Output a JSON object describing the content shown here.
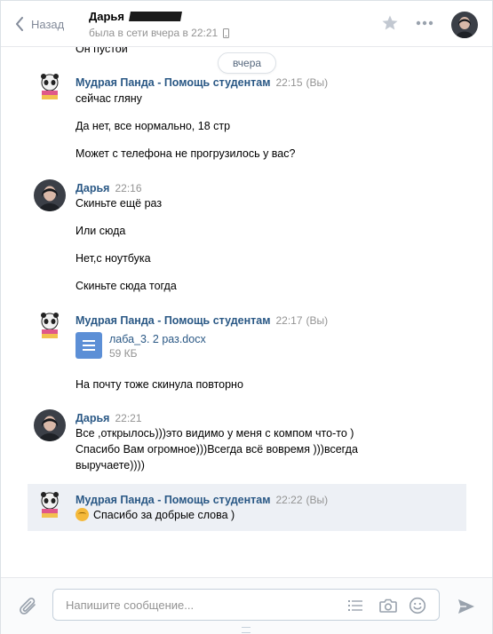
{
  "header": {
    "back_label": "Назад",
    "contact_name": "Дарья",
    "status": "была в сети вчера в 22:21"
  },
  "date_divider": "вчера",
  "messages": [
    {
      "text": "Он пустой"
    },
    {
      "author": "Мудрая Панда - Помощь студентам",
      "time": "22:15",
      "you": "(Вы)",
      "lines": [
        "сейчас гляну",
        "Да нет, все нормально, 18 стр",
        "Может с телефона не прогрузилось у вас?"
      ]
    },
    {
      "author": "Дарья",
      "time": "22:16",
      "lines": [
        "Скиньте ещё раз",
        "Или сюда",
        "Нет,с ноутбука",
        "Скиньте сюда тогда"
      ]
    },
    {
      "author": "Мудрая Панда - Помощь студентам",
      "time": "22:17",
      "you": "(Вы)",
      "doc": {
        "name": "лаба_3. 2 раз.docx",
        "size": "59 КБ"
      },
      "lines": [
        "На почту тоже скинула повторно"
      ]
    },
    {
      "author": "Дарья",
      "time": "22:21",
      "lines": [
        "Все ,открылось)))это видимо у меня с компом что-то )",
        "Спасибо Вам огромное)))Всегда всё вовремя )))всегда",
        "выручаете))))"
      ]
    },
    {
      "author": "Мудрая Панда - Помощь студентам",
      "time": "22:22",
      "you": "(Вы)",
      "lines": [
        "Спасибо за добрые слова )"
      ]
    }
  ],
  "composer": {
    "placeholder": "Напишите сообщение..."
  },
  "colors": {
    "link": "#2a5885",
    "muted": "#939393",
    "highlight": "#edf0f5",
    "doc_icon": "#5c8fd6"
  }
}
